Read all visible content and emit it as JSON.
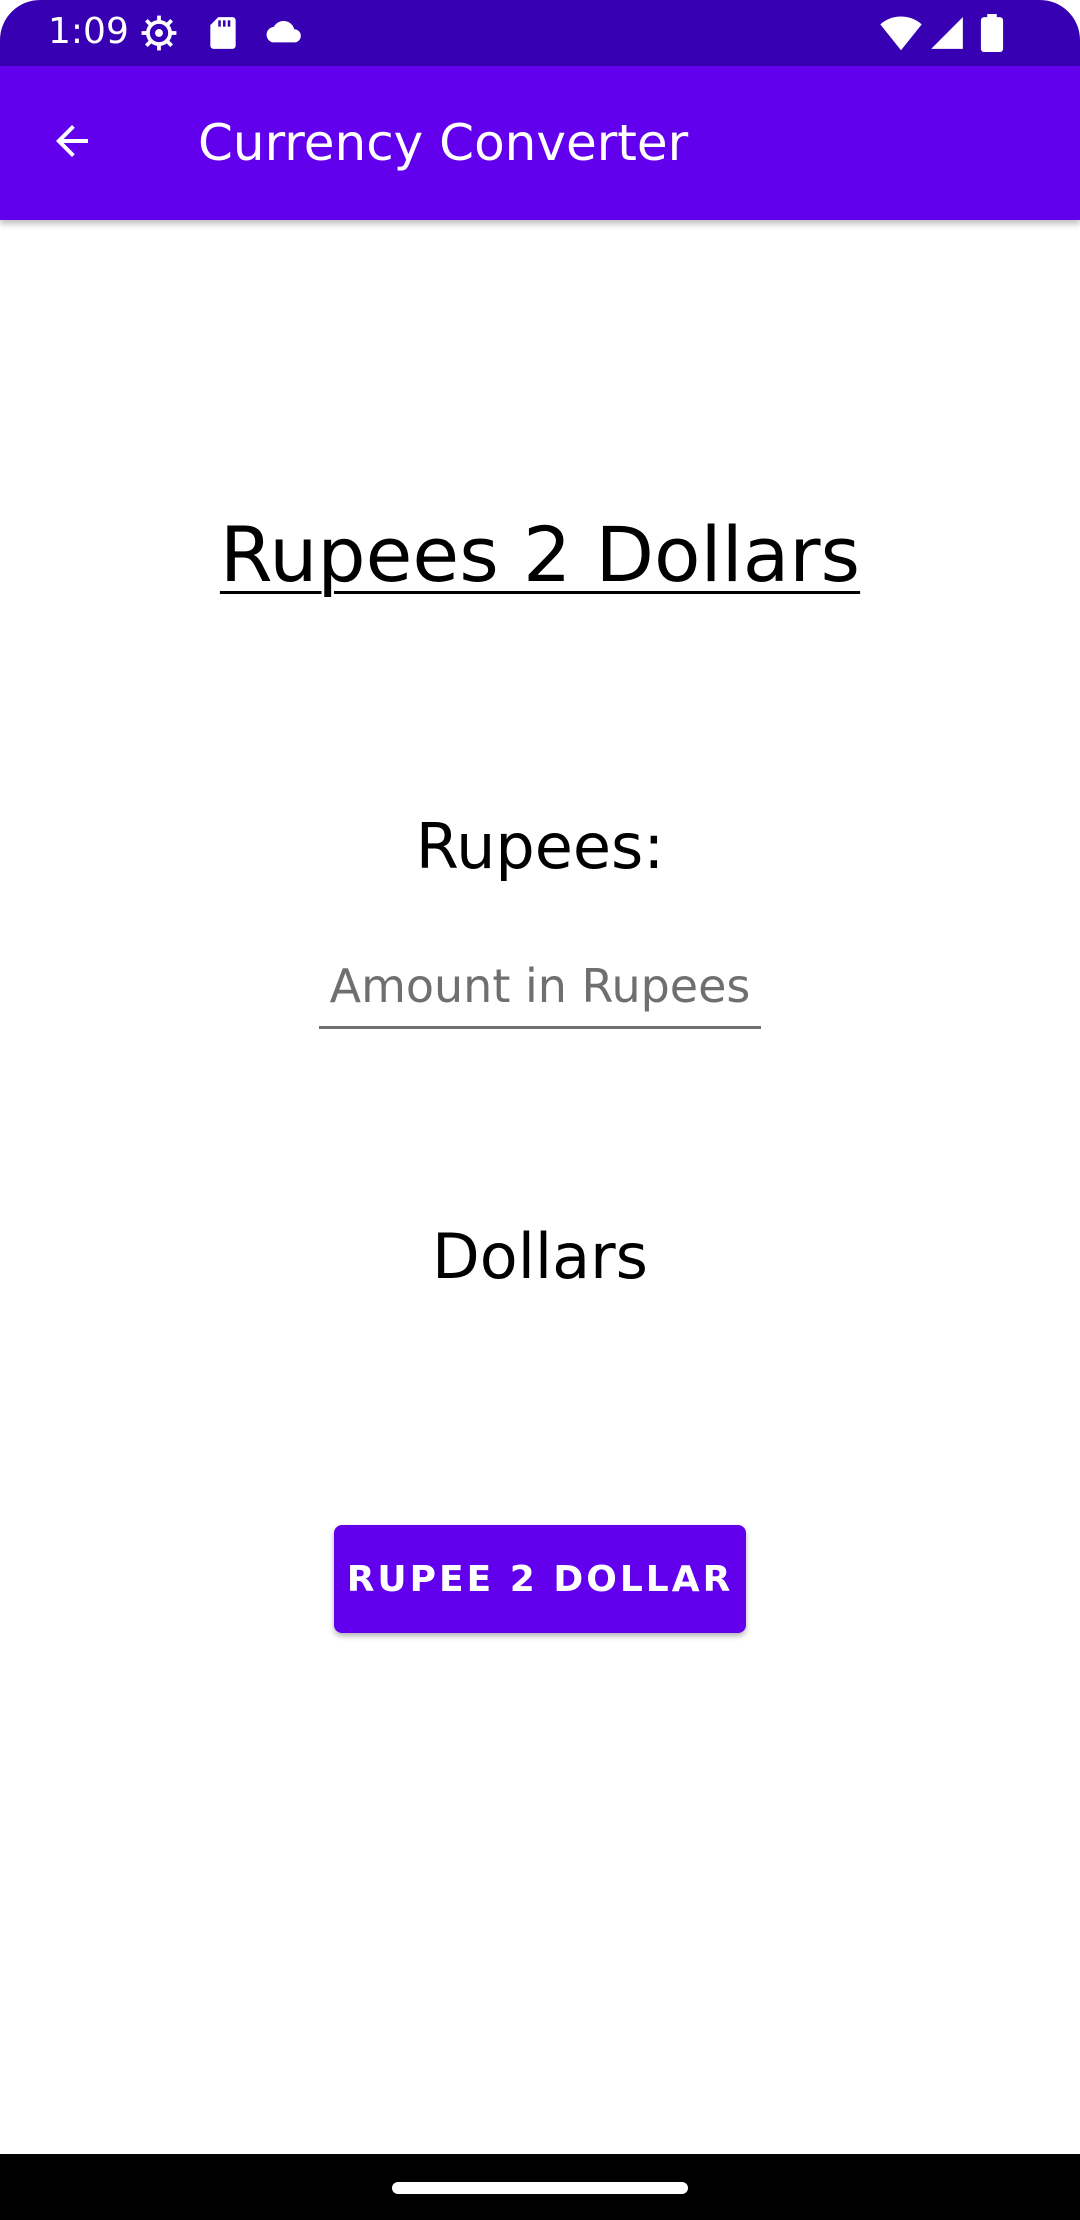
{
  "status_bar": {
    "time": "1:09",
    "icons_left": [
      "settings-gear-icon",
      "sd-card-icon",
      "cloud-icon"
    ],
    "icons_right": [
      "wifi-icon",
      "cellular-signal-icon",
      "battery-icon"
    ]
  },
  "app_bar": {
    "title": "Currency Converter",
    "back_icon": "arrow-back-icon"
  },
  "main": {
    "heading": "Rupees 2 Dollars",
    "rupees_label": "Rupees:",
    "amount_placeholder": "Amount in Rupees",
    "amount_value": "",
    "dollars_label": "Dollars",
    "convert_button": "RUPEE 2 DOLLAR"
  },
  "colors": {
    "status_bar": "#3700B3",
    "app_bar": "#6200EE",
    "button": "#6200EE",
    "background": "#FFFFFF"
  }
}
